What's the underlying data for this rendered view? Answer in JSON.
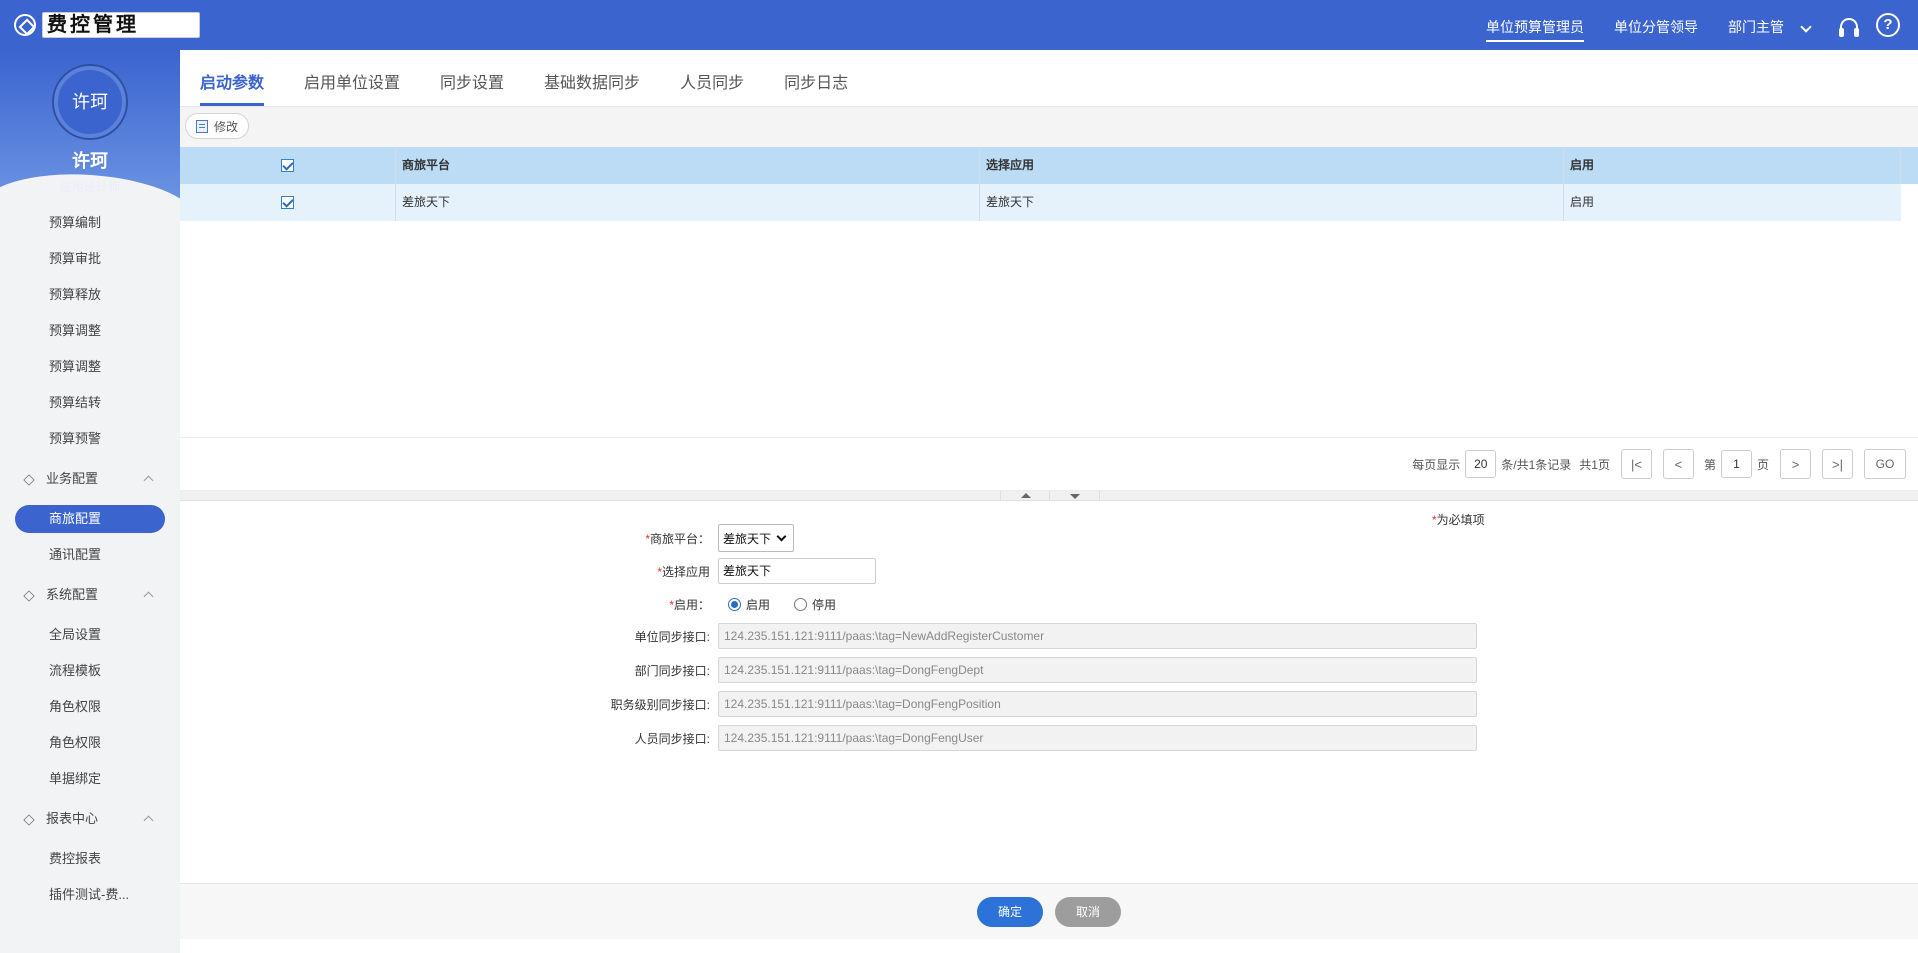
{
  "app": {
    "title": "费控管理"
  },
  "header": {
    "roles": [
      "单位预算管理员",
      "单位分管领导",
      "部门主管"
    ],
    "active_role": "单位预算管理员"
  },
  "user": {
    "name": "许珂",
    "avatar_text": "许珂",
    "role": "应用设计师"
  },
  "sidebar": {
    "items_top": [
      "预算编制",
      "预算审批",
      "预算释放",
      "预算调整",
      "预算调整",
      "预算结转",
      "预算预警"
    ],
    "group_business": {
      "label": "业务配置",
      "items": [
        "商旅配置",
        "通讯配置"
      ]
    },
    "group_system": {
      "label": "系统配置",
      "items": [
        "全局设置",
        "流程模板",
        "角色权限",
        "角色权限",
        "单据绑定"
      ]
    },
    "group_report": {
      "label": "报表中心",
      "items": [
        "费控报表",
        "插件测试-费..."
      ]
    }
  },
  "tabs": [
    "启动参数",
    "启用单位设置",
    "同步设置",
    "基础数据同步",
    "人员同步",
    "同步日志"
  ],
  "toolbar": {
    "edit_label": "修改"
  },
  "grid": {
    "columns": [
      "商旅平台",
      "选择应用",
      "启用"
    ],
    "rows": [
      {
        "platform": "差旅天下",
        "app": "差旅天下",
        "enabled": "启用"
      }
    ]
  },
  "pager": {
    "per_page_label": "每页显示",
    "page_size": "20",
    "summary": "条/共1条记录",
    "total_pages": "共1页",
    "page_prefix": "第",
    "current_page": "1",
    "page_suffix": "页",
    "go_label": "GO"
  },
  "form": {
    "required_note": "为必填项",
    "platform_label": "商旅平台：",
    "platform_value": "差旅天下",
    "app_label": "选择应用",
    "app_value": "差旅天下",
    "enable_label": "启用：",
    "enable_on": "启用",
    "enable_off": "停用",
    "unit_sync_label": "单位同步接口:",
    "unit_sync_value": "124.235.151.121:9111/paas:\\tag=NewAddRegisterCustomer",
    "dept_sync_label": "部门同步接口:",
    "dept_sync_value": "124.235.151.121:9111/paas:\\tag=DongFengDept",
    "position_sync_label": "职务级别同步接口:",
    "position_sync_value": "124.235.151.121:9111/paas:\\tag=DongFengPosition",
    "user_sync_label": "人员同步接口:",
    "user_sync_value": "124.235.151.121:9111/paas:\\tag=DongFengUser"
  },
  "footer": {
    "ok_label": "确定",
    "cancel_label": "取消"
  },
  "colors": {
    "primary": "#3b64cf",
    "grid_header": "#bcdcf5",
    "grid_row": "#e5f1fb",
    "ok_button": "#2d72d9",
    "cancel_button": "#9d9d9d"
  }
}
